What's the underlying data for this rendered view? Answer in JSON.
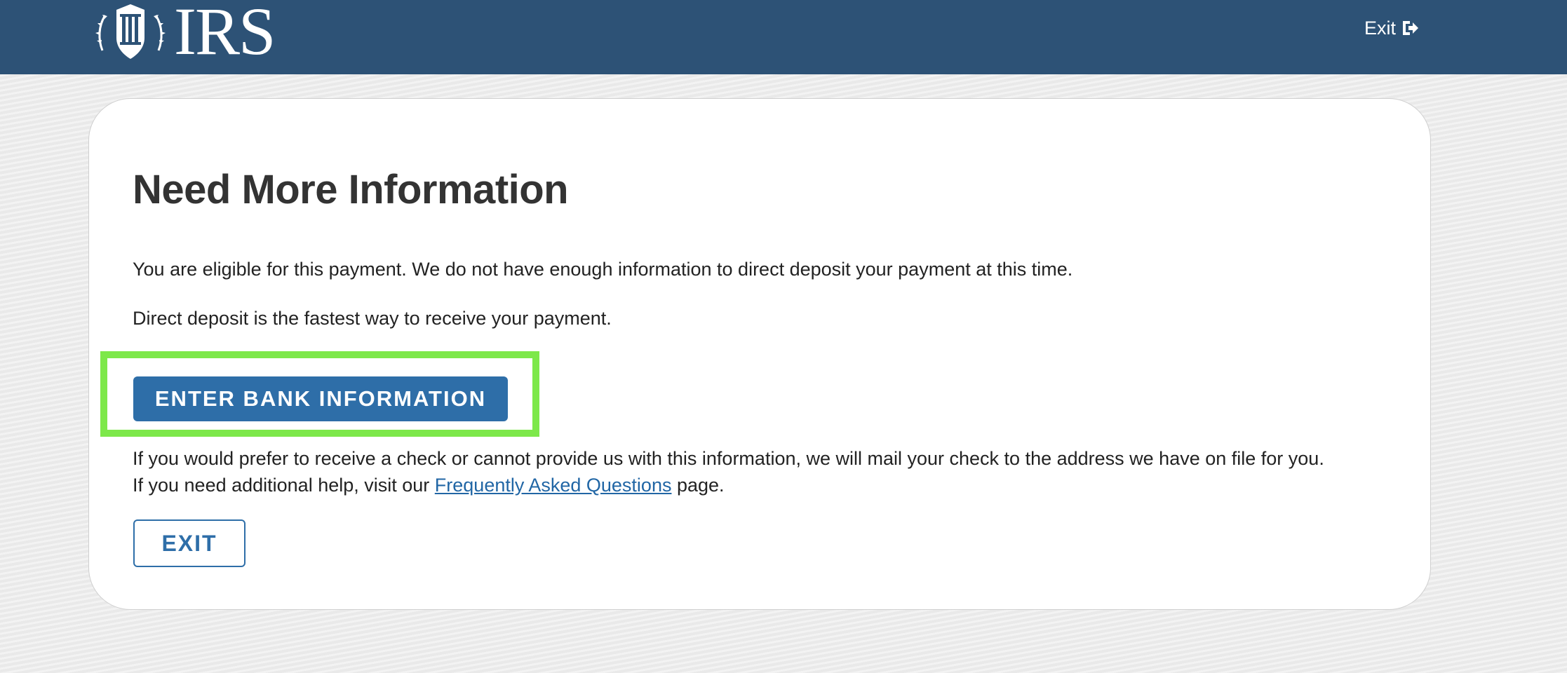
{
  "header": {
    "logo_text": "IRS",
    "exit_label": "Exit"
  },
  "main": {
    "title": "Need More Information",
    "paragraph_eligible": "You are eligible for this payment. We do not have enough information to direct deposit your payment at this time.",
    "paragraph_fastest": "Direct deposit is the fastest way to receive your payment.",
    "enter_bank_button": "ENTER BANK INFORMATION",
    "paragraph_check": "If you would prefer to receive a check or cannot provide us with this information, we will mail your check to the address we have on file for you.",
    "help_prefix": "If you need additional help, visit our ",
    "faq_link": "Frequently Asked Questions",
    "help_suffix": " page.",
    "exit_button": "EXIT"
  },
  "colors": {
    "header_bg": "#2d5276",
    "primary_button": "#2e6ea8",
    "highlight": "#7de84a",
    "link": "#2166a5"
  },
  "icons": {
    "logo": "irs-eagle-seal-icon",
    "exit": "sign-out-icon"
  }
}
